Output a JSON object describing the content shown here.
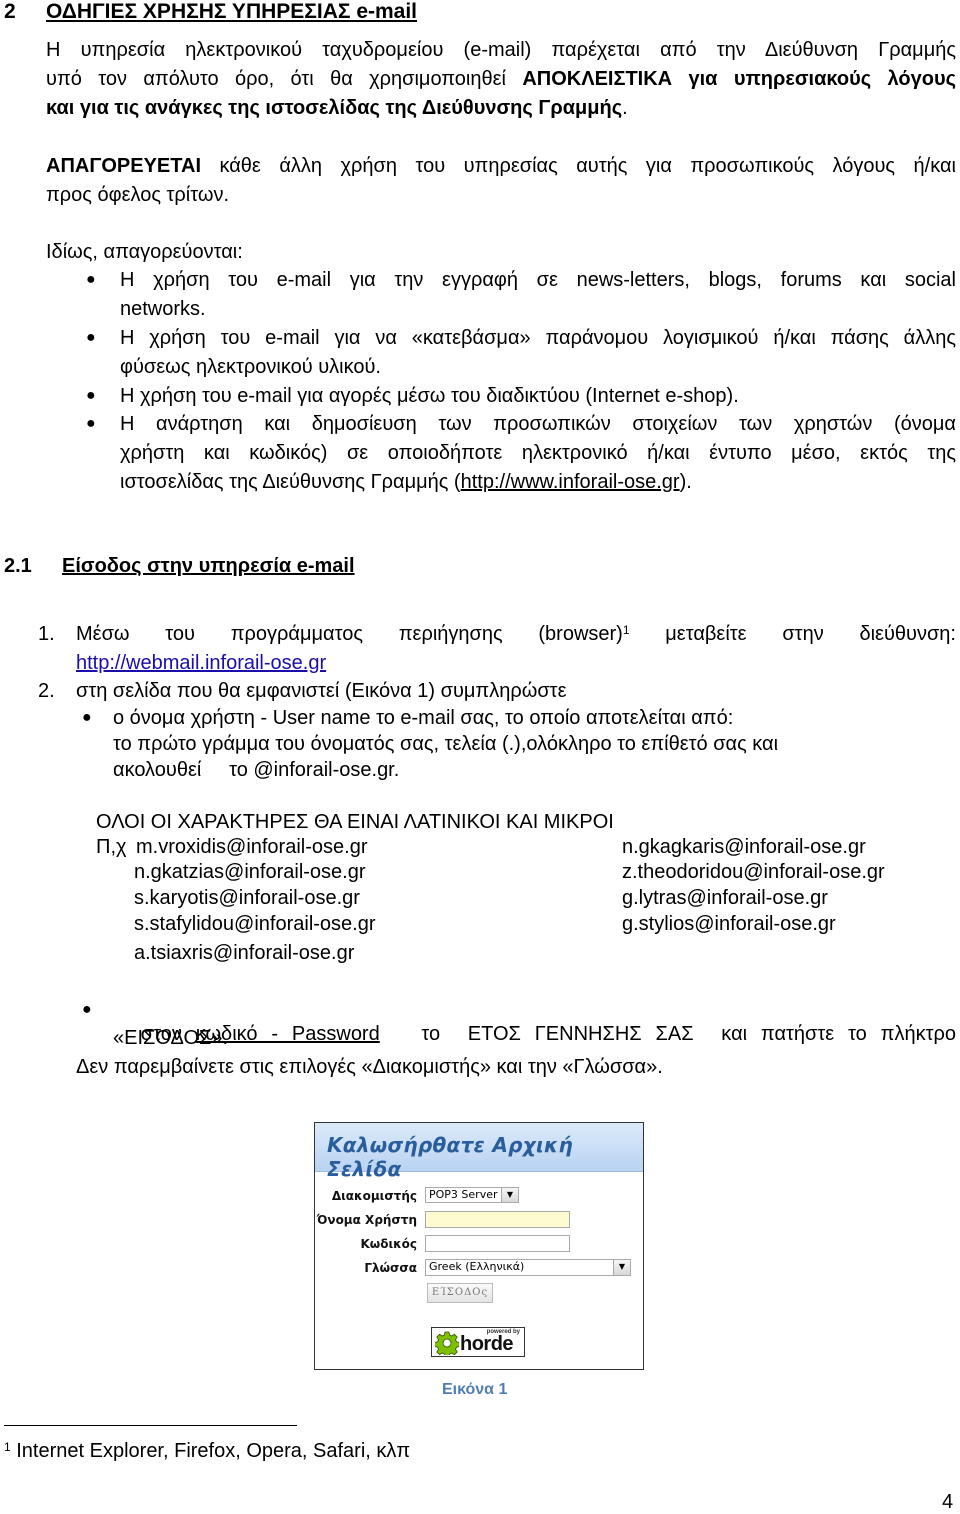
{
  "section": {
    "number": "2",
    "title": "ΟΔΗΓΙΕΣ ΧΡΗΣΗΣ ΥΠΗΡΕΣΙΑΣ e-mail"
  },
  "intro": {
    "line1": "Η υπηρεσία ηλεκτρονικού ταχυδρομείου (e-mail) παρέχεται από την Διεύθυνση Γραμμής",
    "line2_normal": "υπό τον απόλυτο όρο, ότι θα χρησιμοποιηθεί ",
    "line2_bold": "ΑΠΟΚΛΕΙΣΤΙΚΑ για υπηρεσιακούς λόγους",
    "line3_bold": "και για τις ανάγκες της ιστοσελίδας της Διεύθυνσης Γραμμής",
    "line3_end": "."
  },
  "prohibition": {
    "bold": "ΑΠΑΓΟΡΕΥΕΤΑΙ",
    "line1_rest": " κάθε άλλη χρήση του υπηρεσίας αυτής για προσωπικούς λόγους ή/και",
    "line2": "προς όφελος τρίτων."
  },
  "especially": {
    "label": "Ιδίως, απαγορεύονται:",
    "items": [
      {
        "lines": [
          "Η χρήση του e-mail για την εγγραφή σε news-letters, blogs, forums και  social",
          "networks."
        ]
      },
      {
        "lines": [
          "Η χρήση του e-mail για να «κατεβάσμα» παράνομου λογισμικού ή/και πάσης άλλης",
          "φύσεως ηλεκτρονικού υλικού."
        ]
      },
      {
        "lines": [
          "Η χρήση του e-mail για αγορές μέσω του διαδικτύου (Internet e-shop)."
        ]
      },
      {
        "lines": [
          "Η ανάρτηση και δημοσίευση των προσωπικών στοιχείων των χρηστών (όνομα",
          "χρήστη και κωδικός) σε οποιοδήποτε ηλεκτρονικό ή/και έντυπο μέσο, εκτός της"
        ],
        "last_pre": "ιστοσελίδας της Διεύθυνσης Γραμμής (",
        "last_link": "http://www.inforail-ose.gr",
        "last_post": ")."
      }
    ]
  },
  "subsection": {
    "number": "2.1",
    "title": "Είσοδος στην υπηρεσία e-mail"
  },
  "steps": [
    {
      "num": "1.",
      "text_pre": "Μέσω του προγράμματος περιήγησης (browser)",
      "sup": "1",
      "text_post": " μεταβείτε στην διεύθυνση:",
      "link": "http://webmail.inforail-ose.gr"
    },
    {
      "num": "2.",
      "text": "στη σελίδα που θα εμφανιστεί (Εικόνα 1) συμπληρώστε"
    }
  ],
  "username_bullet": {
    "line1": "ο όνομα χρήστη - User name το e-mail σας, το οποίο αποτελείται από:",
    "line2": "το πρώτο γράμμα του όνοματός σας, τελεία (.),ολόκληρο το επίθετό σας και",
    "line3": "ακολουθεί     το @inforail-ose.gr."
  },
  "examples": {
    "note": "ΟΛΟΙ ΟΙ ΧΑΡΑΚΤΗΡΕΣ ΘΑ ΕΙΝΑΙ ΛΑΤΙΝΙΚΟΙ ΚΑΙ ΜΙΚΡΟΙ",
    "prefix": "Π,χ",
    "left": [
      "m.vroxidis@inforail-ose.gr",
      "n.gkatzias@inforail-ose.gr",
      "s.karyotis@inforail-ose.gr",
      "s.stafylidou@inforail-ose.gr",
      "a.tsiaxris@inforail-ose.gr"
    ],
    "right": [
      "n.gkagkaris@inforail-ose.gr",
      "z.theodoridou@inforail-ose.gr",
      "g.lytras@inforail-ose.gr",
      "g.stylios@inforail-ose.gr"
    ]
  },
  "password_bullet": {
    "pre": "στον ",
    "underlined": "κωδικό - Password",
    "mid": "   το  ΕΤΟΣ ΓΕΝΝΗΣΗΣ ΣΑΣ  και πατήστε το πλήκτρο",
    "line2": "«ΕΙΣΟΔΟΣ»."
  },
  "no_change_note": "Δεν παρεμβαίνετε στις επιλογές «Διακομιστής» και την «Γλώσσα».",
  "login_screenshot": {
    "title": "Καλωσήρθατε Αρχική Σελίδα",
    "server_label": "Διακομιστής",
    "server_value": "POP3 Server",
    "username_label": "Όνομα Χρήστη",
    "username_value": "",
    "password_label": "Κωδικός",
    "password_value": "",
    "language_label": "Γλώσσα",
    "language_value": "Greek (Ελληνικά)",
    "login_button": "ΕΊΣΟΔΟς",
    "powered_by": "powered by",
    "brand": "horde",
    "colors": {
      "header_top": "#dceafa",
      "header_bottom": "#b9d3f2",
      "title": "#2a5d9c",
      "active_input": "#fffbd0",
      "gear": "#7cc000"
    }
  },
  "figure_caption": "Εικόνα 1",
  "footnote": {
    "marker": "1",
    "text": " Internet Explorer, Firefox, Opera, Safari, κλπ"
  },
  "page_number": "4"
}
